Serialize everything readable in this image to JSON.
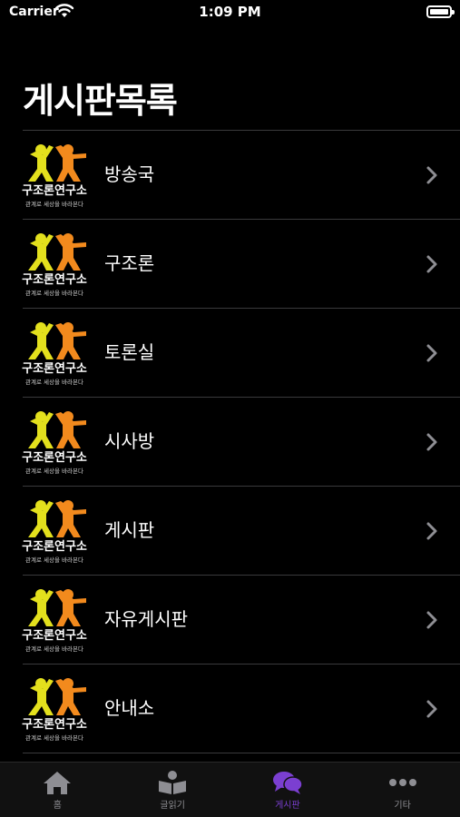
{
  "status_bar": {
    "carrier": "Carrier",
    "time": "1:09 PM"
  },
  "page_title": "게시판목록",
  "logo": {
    "name": "구조론연구소",
    "tagline": "관계로 세상을 바라본다"
  },
  "boards": [
    {
      "label": "방송국"
    },
    {
      "label": "구조론"
    },
    {
      "label": "토론실"
    },
    {
      "label": "시사방"
    },
    {
      "label": "게시판"
    },
    {
      "label": "자유게시판"
    },
    {
      "label": "안내소"
    }
  ],
  "tabs": [
    {
      "label": "홈",
      "icon": "home-icon",
      "active": false
    },
    {
      "label": "글읽기",
      "icon": "reader-icon",
      "active": false
    },
    {
      "label": "게시판",
      "icon": "chat-bubbles-icon",
      "active": true
    },
    {
      "label": "기타",
      "icon": "more-dots-icon",
      "active": false
    }
  ],
  "colors": {
    "accent": "#7b3fd1",
    "inactive": "#8e8e93",
    "logo_yellow": "#e3e01d",
    "logo_orange": "#f28a1d"
  }
}
